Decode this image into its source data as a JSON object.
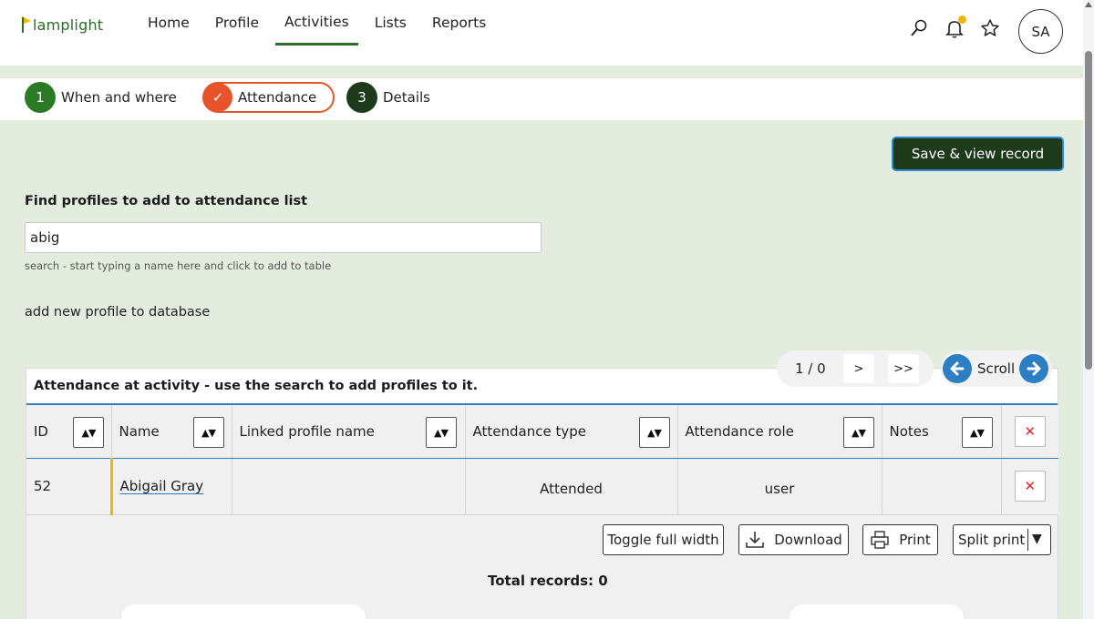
{
  "app": {
    "logo_text": "lamplight"
  },
  "nav": {
    "items": [
      "Home",
      "Profile",
      "Activities",
      "Lists",
      "Reports"
    ],
    "active": "Activities"
  },
  "user": {
    "initials": "SA"
  },
  "steps": [
    {
      "num": "1",
      "label": "When and where",
      "color": "#2a7a26"
    },
    {
      "num": "✓",
      "label": "Attendance",
      "color": "#e8542a"
    },
    {
      "num": "3",
      "label": "Details",
      "color": "#1d3a1a"
    }
  ],
  "save_button": "Save & view record",
  "search": {
    "label": "Find profiles to add to attendance list",
    "value": "abig",
    "hint": "search - start typing a name here and click to add to table"
  },
  "add_new_profile": "add new profile to database",
  "pager": {
    "info": "1 / 0",
    "next": ">",
    "last": ">>"
  },
  "scroll": {
    "label": "Scroll"
  },
  "table": {
    "caption": "Attendance at activity - use the search to add profiles to it.",
    "columns": [
      "ID",
      "Name",
      "Linked profile name",
      "Attendance type",
      "Attendance role",
      "Notes"
    ],
    "rows": [
      {
        "id": "52",
        "name": "Abigail Gray",
        "linked": "",
        "type": "Attended",
        "role": "user",
        "notes": ""
      }
    ]
  },
  "buttons": {
    "toggle": "Toggle full width",
    "download": "Download",
    "print": "Print",
    "split_print": "Split print"
  },
  "total_records": "Total records: 0",
  "colors": {
    "brand_green": "#2a7a26",
    "dark_green": "#1d3a1a",
    "accent_orange": "#e8542a",
    "accent_blue": "#2b7fc2",
    "background": "#e3ecdf"
  }
}
